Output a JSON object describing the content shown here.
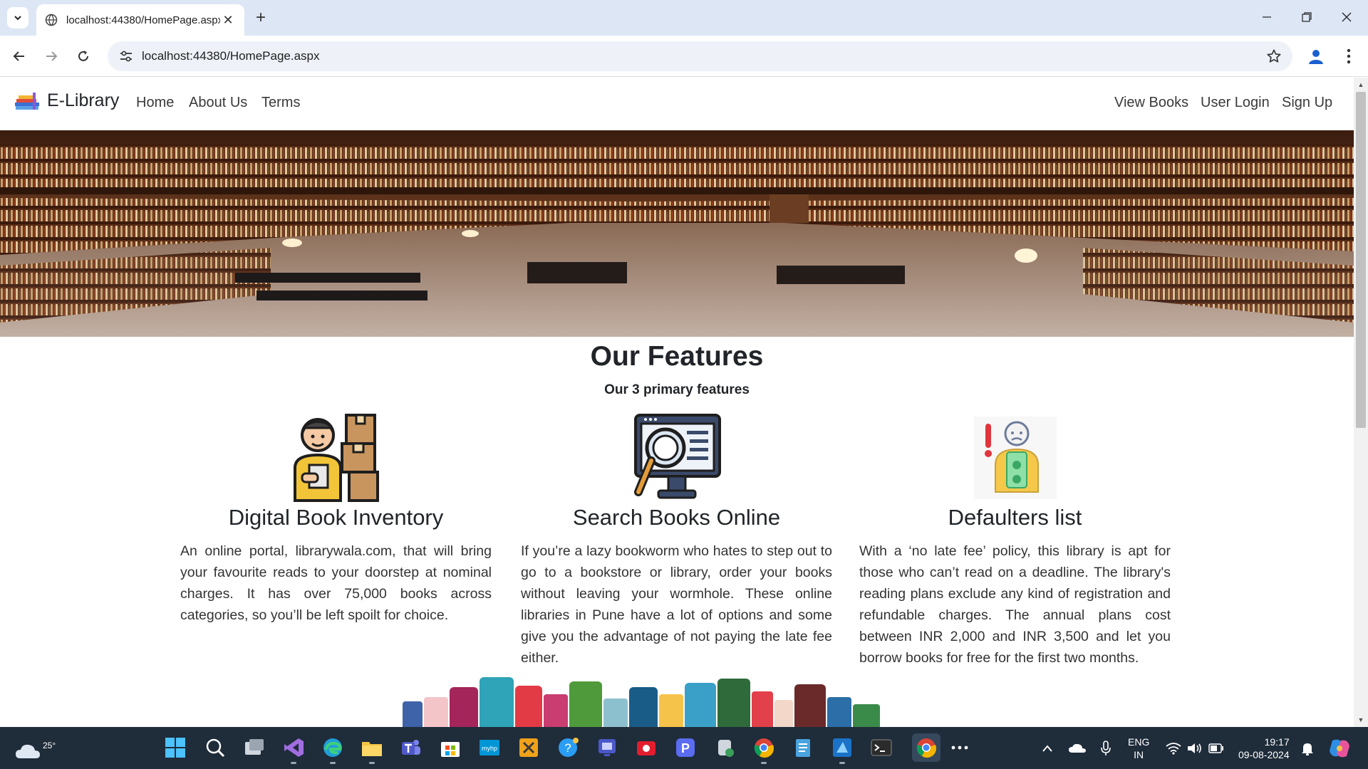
{
  "browser": {
    "tab_title": "localhost:44380/HomePage.aspx",
    "url": "localhost:44380/HomePage.aspx"
  },
  "site": {
    "brand": "E-Library",
    "nav_left": [
      "Home",
      "About Us",
      "Terms"
    ],
    "nav_right": [
      "View Books",
      "User Login",
      "Sign Up"
    ]
  },
  "features": {
    "title": "Our Features",
    "subtitle": "Our 3 primary features",
    "items": [
      {
        "title": "Digital Book Inventory",
        "text": "An online portal, librarywala.com, that will bring your favourite reads to your doorstep at nominal charges. It has over 75,000 books across categories, so you’ll be left spoilt for choice.",
        "icon": "inventory-person-boxes-icon"
      },
      {
        "title": "Search Books Online",
        "text": "If you’re a lazy bookworm who hates to step out to go to a bookstore or library, order your books without leaving your wormhole. These online libraries in Pune have a lot of options and some give you the advantage of not paying the late fee either.",
        "icon": "monitor-magnifier-icon"
      },
      {
        "title": "Defaulters list",
        "text": "With a ‘no late fee’ policy, this library is apt for those who can’t read on a deadline. The library's reading plans exclude any kind of registration and refundable charges. The annual plans cost between INR 2,000 and INR 3,500 and let you borrow books for free for the first two months.",
        "icon": "defaulter-person-alert-icon"
      }
    ]
  },
  "taskbar": {
    "weather_temp": "25°",
    "language": "ENG",
    "region": "IN",
    "time": "19:17",
    "date": "09-08-2024"
  },
  "colors": {
    "tabstrip": "#dde6f5",
    "taskbar": "#1f2c3a",
    "text": "#212529"
  }
}
